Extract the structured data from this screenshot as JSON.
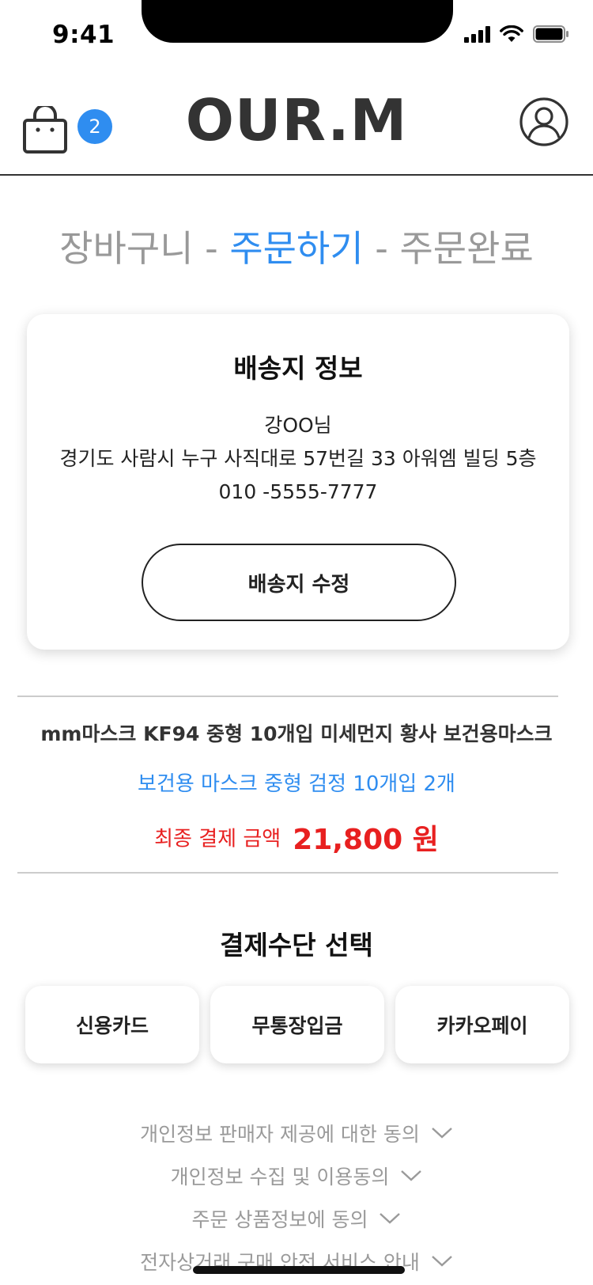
{
  "status_bar": {
    "time": "9:41"
  },
  "header": {
    "brand": "OUR.M",
    "cart_count": "2"
  },
  "steps": {
    "step1": "장바구니",
    "sep1": " - ",
    "step2": "주문하기",
    "sep2": " - ",
    "step3": "주문완료"
  },
  "shipping": {
    "title": "배송지 정보",
    "name": "강OO님",
    "address": "경기도 사람시 누구 사직대로 57번길 33 아워엠 빌딩 5층",
    "phone": "010 -5555-7777",
    "edit_label": "배송지 수정"
  },
  "product": {
    "name": "mm마스크 KF94 중형 10개입 미세먼지 황사 보건용마스크",
    "option": "보건용 마스크 중형 검정 10개입 2개",
    "total_label": "최종 결제 금액",
    "total_amount": "21,800 원"
  },
  "payment": {
    "title": "결제수단 선택",
    "methods": [
      "신용카드",
      "무통장입금",
      "카카오페이"
    ]
  },
  "agreements": [
    "개인정보 판매자 제공에 대한 동의",
    "개인정보 수집 및 이용동의",
    "주문 상품정보에 동의",
    "전자상거래 구매 안전 서비스 안내"
  ],
  "colors": {
    "accent": "#2f8df0",
    "price": "#e82020",
    "muted": "#9a9a9a"
  },
  "icons": [
    "cart-icon",
    "profile-icon",
    "chevron-down-icon",
    "signal-icon",
    "wifi-icon",
    "battery-icon"
  ]
}
